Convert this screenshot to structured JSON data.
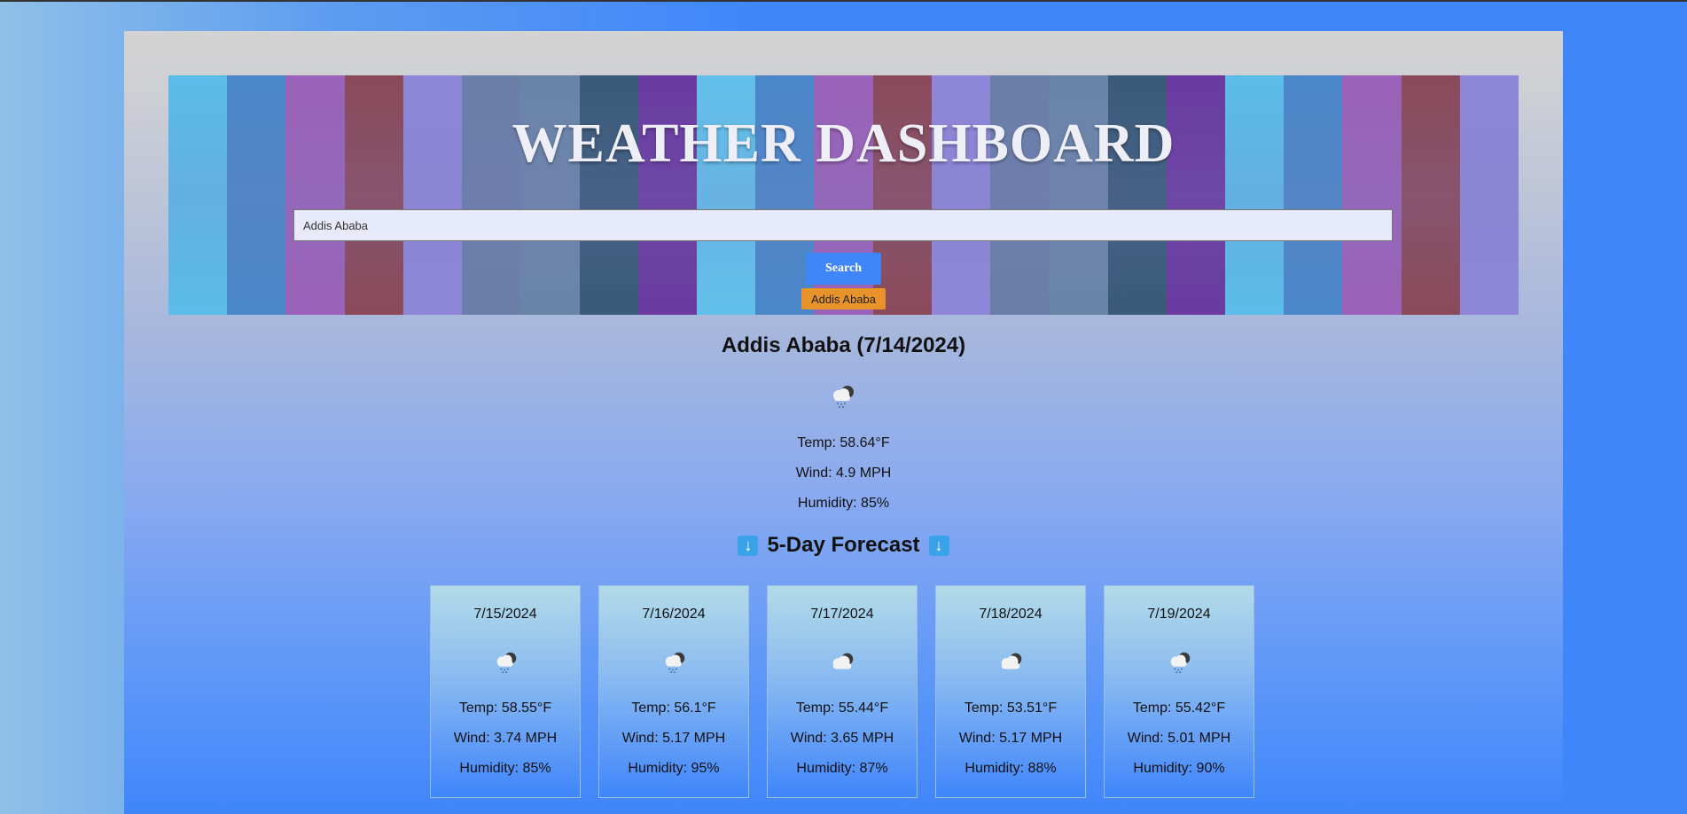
{
  "header": {
    "title": "WEATHER DASHBOARD",
    "search_value": "Addis Ababa",
    "search_button": "Search",
    "history": [
      "Addis Ababa"
    ],
    "strip_colors": [
      "#5cbce8",
      "#4a86c8",
      "#9a62b8",
      "#8a4a5a",
      "#8e86d8",
      "#6a7ea8",
      "#6a84a8",
      "#3a5a78",
      "#6a3aa0",
      "#62c0ea",
      "#4a86c8",
      "#9a62b8",
      "#8a4a5a",
      "#8e86d8",
      "#6a7ea8",
      "#6a84a8",
      "#3a5a78",
      "#6a3aa0",
      "#5cbce8",
      "#4a86c8",
      "#9a62b8",
      "#8a4a5a",
      "#8e86d8"
    ]
  },
  "current": {
    "title": "Addis Ababa (7/14/2024)",
    "icon": "rain-cloud-icon",
    "temp": "Temp: 58.64°F",
    "wind": "Wind: 4.9 MPH",
    "humidity": "Humidity: 85%"
  },
  "forecast": {
    "title": "5-Day Forecast",
    "arrow_icon": "down-arrow-icon",
    "days": [
      {
        "date": "7/15/2024",
        "icon": "rain-cloud-icon",
        "temp": "Temp: 58.55°F",
        "wind": "Wind: 3.74 MPH",
        "humidity": "Humidity: 85%"
      },
      {
        "date": "7/16/2024",
        "icon": "rain-cloud-icon",
        "temp": "Temp: 56.1°F",
        "wind": "Wind: 5.17 MPH",
        "humidity": "Humidity: 95%"
      },
      {
        "date": "7/17/2024",
        "icon": "clouds-icon",
        "temp": "Temp: 55.44°F",
        "wind": "Wind: 3.65 MPH",
        "humidity": "Humidity: 87%"
      },
      {
        "date": "7/18/2024",
        "icon": "clouds-icon",
        "temp": "Temp: 53.51°F",
        "wind": "Wind: 5.17 MPH",
        "humidity": "Humidity: 88%"
      },
      {
        "date": "7/19/2024",
        "icon": "rain-cloud-icon",
        "temp": "Temp: 55.42°F",
        "wind": "Wind: 5.01 MPH",
        "humidity": "Humidity: 90%"
      }
    ]
  }
}
